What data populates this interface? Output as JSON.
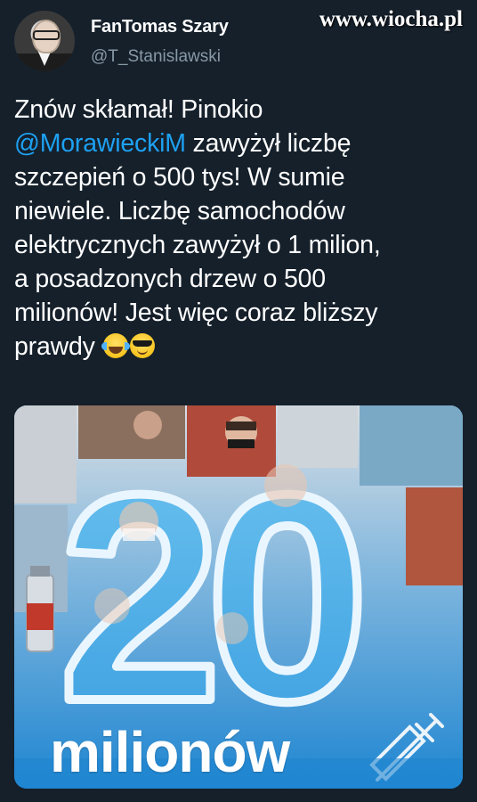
{
  "watermark": "www.wiocha.pl",
  "author": {
    "display_name": "FanTomas Szary",
    "handle": "@T_Stanislawski",
    "avatar_icon": "profile-photo"
  },
  "tweet": {
    "lines": [
      "Znów skłamał! Pinokio",
      "zawyżył liczbę",
      "szczepień o 500 tys! W sumie",
      "niewiele. Liczbę samochodów",
      "elektrycznych zawyżył o 1 milion,",
      "a posadzonych drzew o 500",
      "milionów! Jest więc coraz bliższy",
      "prawdy"
    ],
    "mention": "@MorawieckiM",
    "emojis": [
      "face-with-tears-of-joy",
      "smiling-face-with-sunglasses"
    ]
  },
  "media": {
    "big_number": "20",
    "caption": "milionów",
    "colors": {
      "background": "#2b8fd6",
      "number_fill": "#4fb0ea",
      "number_stroke": "#ffffff"
    },
    "icons": [
      "syringe-icon",
      "vaccine-vial-icon"
    ]
  }
}
